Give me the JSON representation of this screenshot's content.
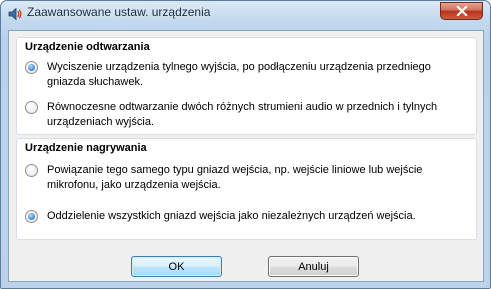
{
  "window": {
    "title": "Zaawansowane ustaw. urządzenia",
    "app_icon": "speaker-icon",
    "close_icon": "close-icon"
  },
  "playback_group": {
    "title": "Urządzenie odtwarzania",
    "options": [
      {
        "label": "Wyciszenie urządzenia tylnego wyjścia, po podłączeniu urządzenia przedniego gniazda słuchawek.",
        "checked": true
      },
      {
        "label": "Równoczesne odtwarzanie dwóch różnych strumieni audio w przednich i tylnych urządzeniach wyjścia.",
        "checked": false
      }
    ]
  },
  "recording_group": {
    "title": "Urządzenie nagrywania",
    "options": [
      {
        "label": "Powiązanie tego samego typu gniazd wejścia, np. wejście liniowe lub wejście mikrofonu, jako urządzenia wejścia.",
        "checked": false
      },
      {
        "label": "Oddzielenie wszystkich gniazd wejścia jako niezależnych urządzeń wejścia.",
        "checked": true
      }
    ]
  },
  "buttons": {
    "ok_label": "OK",
    "cancel_label": "Anuluj"
  },
  "colors": {
    "accent": "#3c7fb1",
    "close_red": "#c7442c",
    "radio_selected": "#4f93d8"
  }
}
